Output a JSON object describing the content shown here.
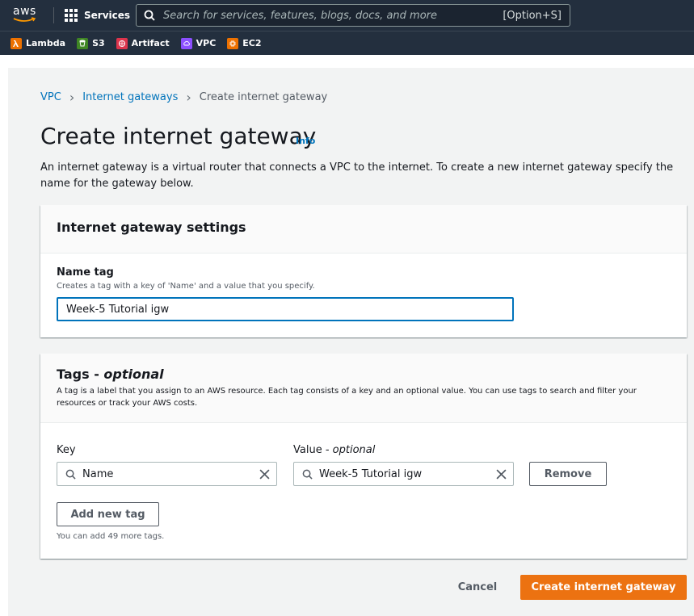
{
  "nav": {
    "logo_text": "aws",
    "services_label": "Services",
    "search_placeholder": "Search for services, features, blogs, docs, and more",
    "search_shortcut": "[Option+S]"
  },
  "favorites": [
    {
      "label": "Lambda",
      "color": "#ed7100",
      "icon": "lambda-icon"
    },
    {
      "label": "S3",
      "color": "#3f8624",
      "icon": "s3-icon"
    },
    {
      "label": "Artifact",
      "color": "#dd344c",
      "icon": "artifact-icon"
    },
    {
      "label": "VPC",
      "color": "#8c4fff",
      "icon": "vpc-icon"
    },
    {
      "label": "EC2",
      "color": "#ed7100",
      "icon": "ec2-icon"
    }
  ],
  "breadcrumb": {
    "items": [
      "VPC",
      "Internet gateways"
    ],
    "current": "Create internet gateway"
  },
  "page": {
    "title": "Create internet gateway",
    "info": "Info",
    "description": "An internet gateway is a virtual router that connects a VPC to the internet. To create a new internet gateway specify the name for the gateway below."
  },
  "settings": {
    "title": "Internet gateway settings",
    "name_label": "Name tag",
    "name_desc": "Creates a tag with a key of 'Name' and a value that you specify.",
    "name_value": "Week-5 Tutorial igw"
  },
  "tags": {
    "title": "Tags - ",
    "title_optional": "optional",
    "description": "A tag is a label that you assign to an AWS resource. Each tag consists of a key and an optional value. You can use tags to search and filter your resources or track your AWS costs.",
    "key_label": "Key",
    "value_label": "Value - ",
    "value_label_optional": "optional",
    "key_value": "Name",
    "value_value": "Week-5 Tutorial igw",
    "remove_label": "Remove",
    "add_label": "Add new tag",
    "note": "You can add 49 more tags."
  },
  "actions": {
    "cancel": "Cancel",
    "create": "Create internet gateway"
  },
  "colors": {
    "nav_bg": "#232f3e",
    "link": "#0073bb",
    "primary": "#ec7211"
  }
}
